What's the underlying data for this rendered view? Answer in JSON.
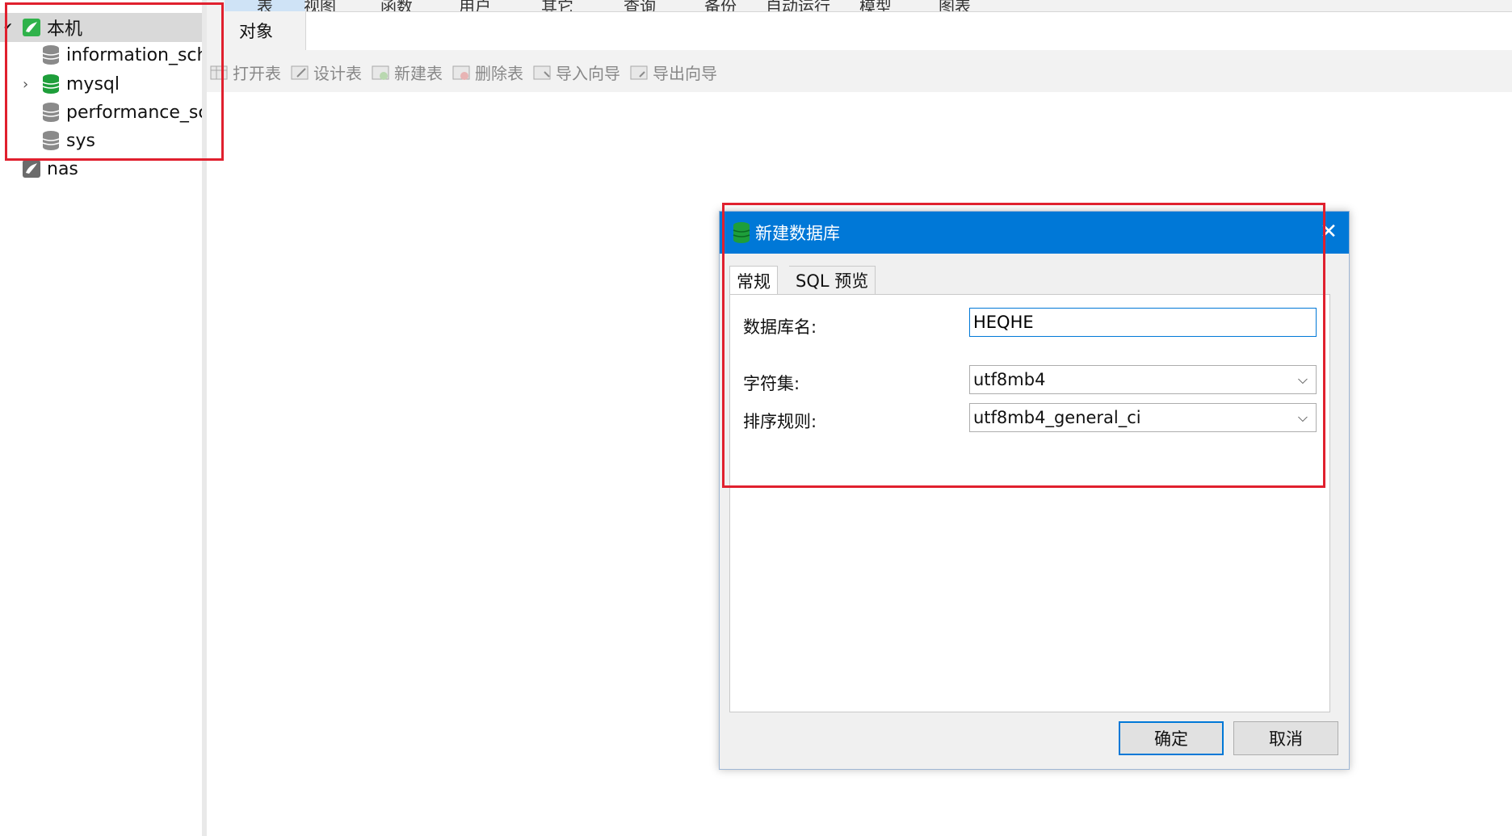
{
  "menu": {
    "items": [
      "表",
      "视图",
      "函数",
      "用户",
      "其它",
      "查询",
      "备份",
      "自动运行",
      "模型",
      "图表"
    ]
  },
  "object_tab": {
    "label": "对象"
  },
  "toolbar": {
    "items": [
      "打开表",
      "设计表",
      "新建表",
      "删除表",
      "导入向导",
      "导出向导"
    ]
  },
  "sidebar": {
    "connection": "本机",
    "databases": [
      "information_schema",
      "mysql",
      "performance_schema",
      "sys"
    ],
    "other_connection": "nas"
  },
  "dialog": {
    "title": "新建数据库",
    "tabs": [
      "常规",
      "SQL 预览"
    ],
    "fields": {
      "name_label": "数据库名:",
      "name_value": "HEQHE",
      "charset_label": "字符集:",
      "charset_value": "utf8mb4",
      "collation_label": "排序规则:",
      "collation_value": "utf8mb4_general_ci"
    },
    "buttons": {
      "ok": "确定",
      "cancel": "取消"
    }
  },
  "colors": {
    "accent": "#0078d7",
    "annotation": "#e0202e",
    "db_active": "#1e9e3a"
  }
}
